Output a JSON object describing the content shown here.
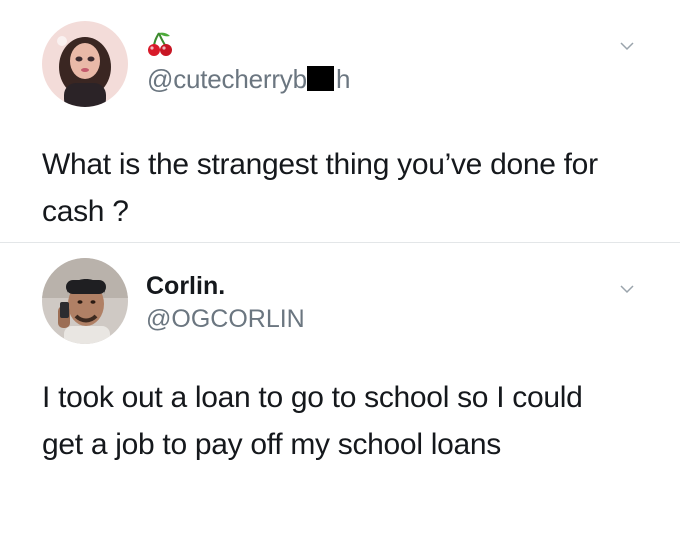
{
  "tweets": [
    {
      "handle_prefix": "@cutecherryb",
      "handle_suffix": "h",
      "emoji": "cherries-icon",
      "text": "What is the strangest thing you’ve done for cash ?"
    },
    {
      "display_name": "Corlin.",
      "handle": "@OGCORLIN",
      "text": "I took out a loan to go to school so I could get a job to pay off my school loans"
    }
  ],
  "colors": {
    "text": "#15181c",
    "secondary_text": "#6b7680",
    "divider": "#e3e6e8",
    "cherry": "#d81b2a",
    "redaction": "#000000"
  }
}
